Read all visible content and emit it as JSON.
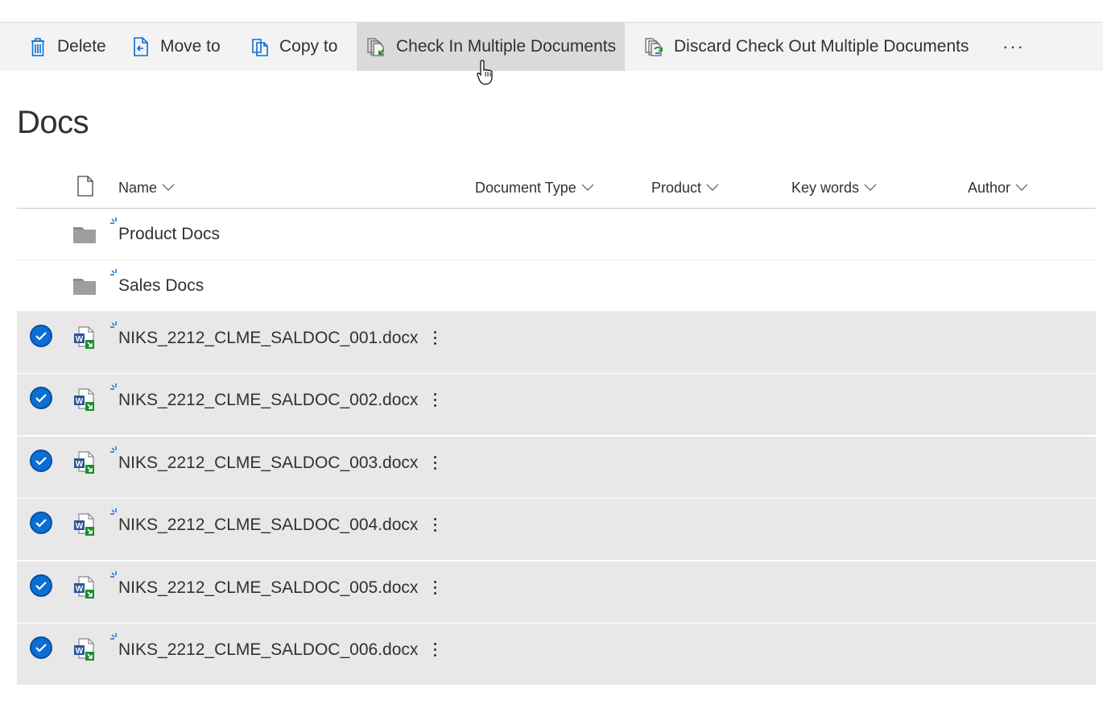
{
  "commandbar": {
    "items": [
      {
        "label": "Delete",
        "icon": "trash-icon"
      },
      {
        "label": "Move to",
        "icon": "move-icon"
      },
      {
        "label": "Copy to",
        "icon": "copy-icon"
      },
      {
        "label": "Check In Multiple Documents",
        "icon": "check-in-icon"
      },
      {
        "label": "Discard Check Out Multiple Documents",
        "icon": "discard-checkout-icon"
      }
    ],
    "more_label": "···",
    "hovered_item": "Check In Multiple Documents"
  },
  "page": {
    "title": "Docs"
  },
  "columns": [
    {
      "label": "Name"
    },
    {
      "label": "Document Type"
    },
    {
      "label": "Product"
    },
    {
      "label": "Key words"
    },
    {
      "label": "Author"
    }
  ],
  "folders": [
    {
      "name": "Product Docs"
    },
    {
      "name": "Sales Docs"
    }
  ],
  "files": [
    {
      "name": "NIKS_2212_CLME_SALDOC_001.docx",
      "selected": true
    },
    {
      "name": "NIKS_2212_CLME_SALDOC_002.docx",
      "selected": true
    },
    {
      "name": "NIKS_2212_CLME_SALDOC_003.docx",
      "selected": true
    },
    {
      "name": "NIKS_2212_CLME_SALDOC_004.docx",
      "selected": true
    },
    {
      "name": "NIKS_2212_CLME_SALDOC_005.docx",
      "selected": true
    },
    {
      "name": "NIKS_2212_CLME_SALDOC_006.docx",
      "selected": true
    }
  ],
  "colors": {
    "accent": "#0b6ed4",
    "commandbar_bg": "#f3f3f3",
    "hover_bg": "#dadada",
    "selected_row_bg": "#e8e8e8",
    "new_marker": "#0b6ed4"
  }
}
